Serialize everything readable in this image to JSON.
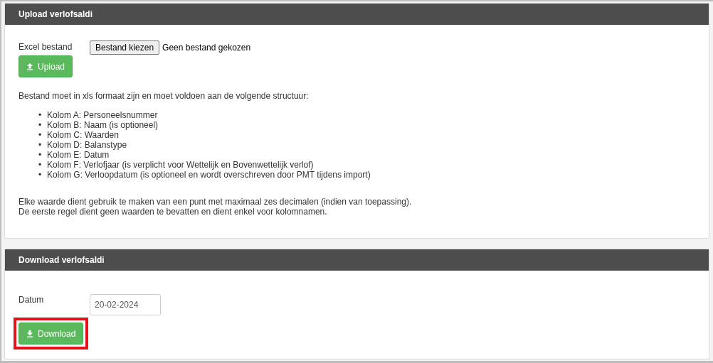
{
  "upload_panel": {
    "title": "Upload verlofsaldi",
    "field_label": "Excel bestand",
    "file_button": "Bestand kiezen",
    "file_status": "Geen bestand gekozen",
    "upload_button": "Upload",
    "intro": "Bestand moet in xls formaat zijn en moet voldoen aan de volgende structuur:",
    "columns": [
      {
        "marker": "•",
        "text": "Kolom A: Personeelsnummer"
      },
      {
        "marker": "•",
        "text": "Kolom B: Naam (is optioneel)"
      },
      {
        "marker": "•",
        "text": "Kolom C: Waarden"
      },
      {
        "marker": "•",
        "text": "Kolom D: Balanstype"
      },
      {
        "marker": "•",
        "text": "Kolom E: Datum"
      },
      {
        "marker": "•",
        "text": "Kolom F: Verlofjaar (is verplicht voor Wettelijk en Bovenwettelijk verlof)"
      },
      {
        "marker": "•",
        "text": "Kolom G: Verloopdatum (is optioneel en wordt overschreven door PMT tijdens import)"
      }
    ],
    "notes": [
      "Elke waarde dient gebruik te maken van een punt met maximaal zes decimalen (indien van toepassing).",
      "De eerste regel dient geen waarden te bevatten en dient enkel voor kolomnamen."
    ]
  },
  "download_panel": {
    "title": "Download verlofsaldi",
    "field_label": "Datum",
    "date_value": "20-02-2024",
    "download_button": "Download",
    "highlighted": true
  }
}
